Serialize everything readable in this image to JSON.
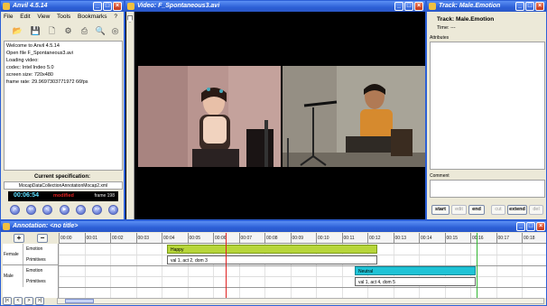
{
  "main_window": {
    "title": "Anvil 4.5.14",
    "menu": [
      "File",
      "Edit",
      "View",
      "Tools",
      "Bookmarks",
      "?"
    ],
    "log_lines": [
      "Welcome to Anvil 4.5.14",
      "Open file F_Spontaneous3.avi",
      "Loading video:",
      "   codec: Intel Indeo 5.0",
      "   screen size: 720x480",
      "   frame rate: 29.9697303771972 66fps"
    ],
    "spec_label": "Current specification:",
    "spec_file": "MocapDataCollectionAnnotationMocap2.xml",
    "timecode": "00:06:54",
    "modified": "modified",
    "frame": "frame 198"
  },
  "video_window": {
    "title": "Video: F_Spontaneous3.avi"
  },
  "track_window": {
    "title": "Track: Male.Emotion",
    "track_name": "Track: Male.Emotion",
    "time": "Time: ---",
    "attributes_label": "Attributes",
    "comment_label": "Comment",
    "buttons": {
      "start": "start",
      "edit": "edit",
      "end": "end",
      "cut": "cut",
      "extend": "extend",
      "del": "del"
    }
  },
  "annotation_window": {
    "title": "Annotation: <no title>",
    "plus": "+",
    "minus": "−",
    "ticks": [
      "00:00",
      "00:01",
      "00:02",
      "00:03",
      "00:04",
      "00:05",
      "00:06",
      "00:07",
      "00:08",
      "00:09",
      "00:10",
      "00:11",
      "00:12",
      "00:13",
      "00:14",
      "00:15",
      "00:16",
      "00:17",
      "00:18"
    ],
    "groups": [
      {
        "name": "Female",
        "tracks": [
          "Emotion",
          "Primitives"
        ]
      },
      {
        "name": "Male",
        "tracks": [
          "Emotion",
          "Primitives"
        ]
      }
    ],
    "segments": {
      "female_emotion": "Happy",
      "female_primitives": "val 1, act 2, dom 3",
      "male_emotion": "Neutral",
      "male_primitives": "val 1, act 4, dom 5"
    }
  },
  "colors": {
    "desktop": "#3b68c9",
    "happy": "#b7d63a",
    "neutral": "#1fc3d6",
    "playhead": "#e02020",
    "marker": "#32b832"
  }
}
